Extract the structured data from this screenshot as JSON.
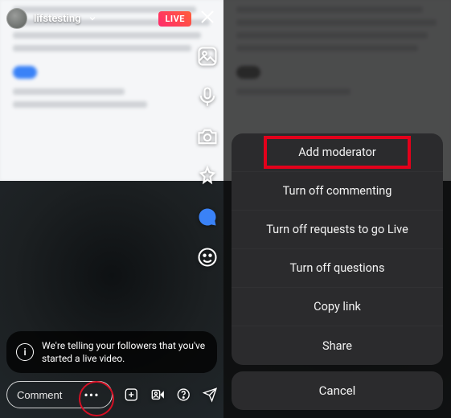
{
  "left": {
    "username": "lifstesting",
    "live_badge": "LIVE",
    "toast": "We're telling your followers that you've started a live video.",
    "comment_placeholder": "Comment"
  },
  "sheet": {
    "items": [
      "Add moderator",
      "Turn off commenting",
      "Turn off requests to go Live",
      "Turn off questions",
      "Copy link",
      "Share"
    ],
    "cancel": "Cancel"
  }
}
